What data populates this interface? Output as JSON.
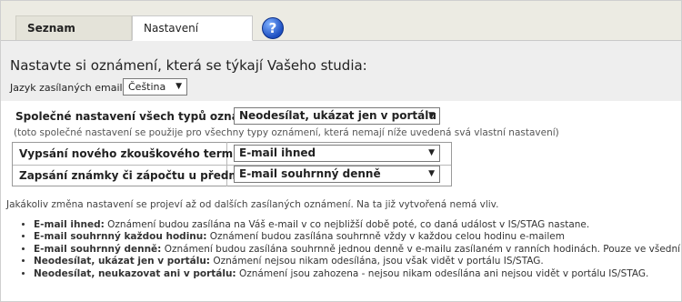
{
  "tabs": [
    {
      "label": "Seznam oznámení",
      "active": false
    },
    {
      "label": "Nastavení odesílání",
      "active": true
    }
  ],
  "help_icon": {
    "icon": "help-icon",
    "glyph": "?"
  },
  "heading": "Nastavte si oznámení, která se týkají Vašeho studia:",
  "language": {
    "label": "Jazyk zasílaných emailů",
    "value": "Čeština"
  },
  "common_setting": {
    "label": "Společné nastavení všech typů oznámení:",
    "value": "Neodesílat, ukázat jen v portálu",
    "note": "(toto společné nastavení se použije pro všechny typy oznámení, která nemají níže uvedená svá vlastní nastavení)"
  },
  "settings": [
    {
      "label": "Vypsání nového zkouškového termínu",
      "value": "E-mail ihned"
    },
    {
      "label": "Zapsání známky či zápočtu u předmětu",
      "value": "E-mail souhrnný denně"
    }
  ],
  "info_text": "Jakákoliv změna nastavení se projeví až od dalších zasílaných oznámení. Na ta již vytvořená nemá vliv.",
  "legend": [
    {
      "term": "E-mail ihned:",
      "desc": " Oznámení budou zasílána na Váš e-mail v co nejbližší době poté, co daná událost v IS/STAG nastane."
    },
    {
      "term": "E-mail souhrnný každou hodinu:",
      "desc": " Oznámení budou zasílána souhrnně vždy v každou celou hodinu e-mailem"
    },
    {
      "term": "E-mail souhrnný denně:",
      "desc": " Oznámení budou zasílána souhrnně jednou denně v e-mailu zasílaném v ranních hodinách. Pouze ve všední dny."
    },
    {
      "term": "Neodesílat, ukázat jen v portálu:",
      "desc": " Oznámení nejsou nikam odesílána, jsou však vidět v portálu IS/STAG."
    },
    {
      "term": "Neodesílat, neukazovat ani v portálu:",
      "desc": " Oznámení jsou zahozena - nejsou nikam odesílána ani nejsou vidět v portálu IS/STAG."
    }
  ],
  "select_arrow": "▼"
}
